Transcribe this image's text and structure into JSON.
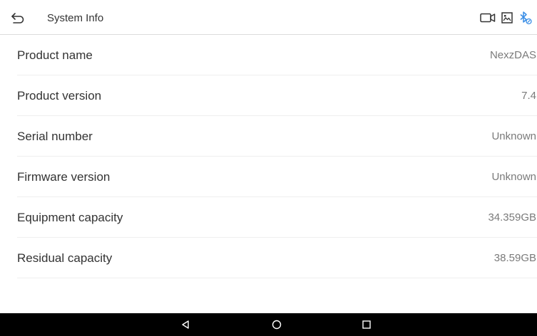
{
  "header": {
    "title": "System Info",
    "back_icon": "back-arrow-icon",
    "status_icons": [
      "video-camera-icon",
      "gallery-icon",
      "bluetooth-icon"
    ],
    "bluetooth_color": "#3a8ee6"
  },
  "info_rows": [
    {
      "label": "Product name",
      "value": "NexzDAS"
    },
    {
      "label": "Product version",
      "value": "7.4"
    },
    {
      "label": "Serial number",
      "value": "Unknown"
    },
    {
      "label": "Firmware version",
      "value": "Unknown"
    },
    {
      "label": "Equipment capacity",
      "value": "34.359GB"
    },
    {
      "label": "Residual capacity",
      "value": "38.59GB"
    }
  ],
  "nav_bar": {
    "buttons": [
      "back-triangle-icon",
      "home-circle-icon",
      "recents-square-icon"
    ]
  }
}
